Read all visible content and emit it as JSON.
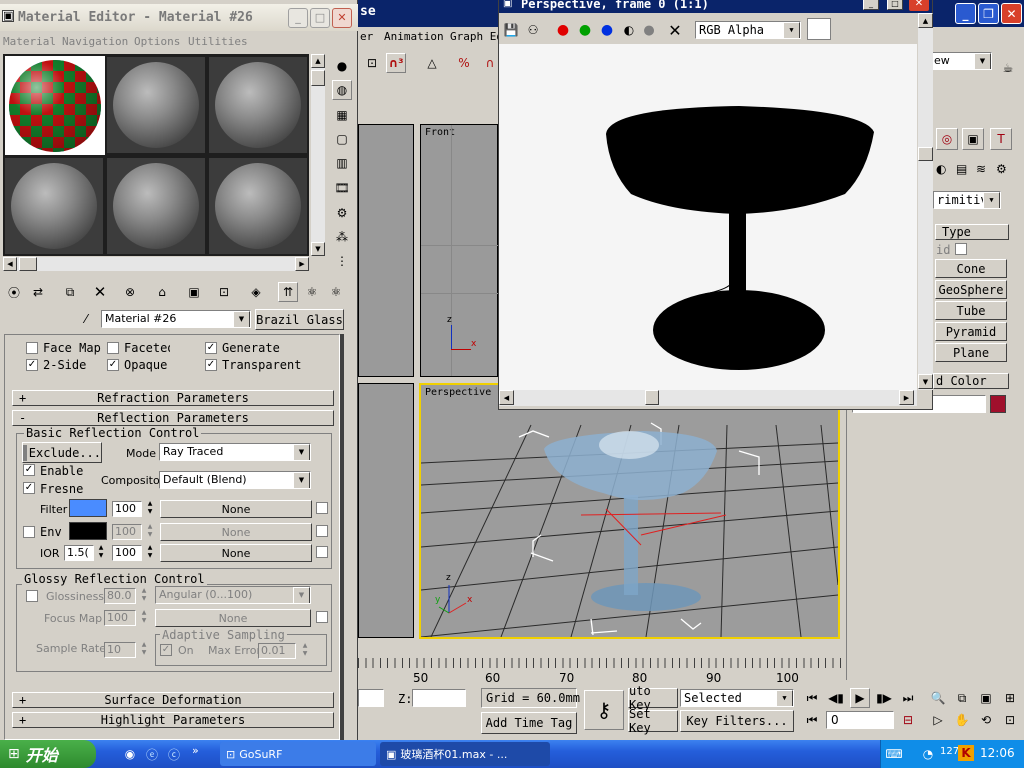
{
  "material_editor": {
    "title": "Material Editor - Material #26",
    "menu": [
      "Material",
      "Navigation",
      "Options",
      "Utilities"
    ],
    "material_name": "Material #26",
    "material_type": "Brazil Glass",
    "checks": [
      {
        "label": "Face Map",
        "checked": false
      },
      {
        "label": "Faceted",
        "checked": false
      },
      {
        "label": "Generate",
        "checked": true
      },
      {
        "label": "2-Side",
        "checked": true
      },
      {
        "label": "Opaque",
        "checked": true
      },
      {
        "label": "Transparent",
        "checked": true
      }
    ],
    "rollouts": {
      "refraction": "Refraction Parameters",
      "reflection": "Reflection Parameters",
      "surface": "Surface Deformation",
      "highlight": "Highlight Parameters",
      "plus": "+",
      "minus": "-"
    },
    "basic": {
      "group": "Basic Reflection Control",
      "exclude": "Exclude...",
      "mode_label": "Mode",
      "mode_value": "Ray Traced",
      "enable": "Enable",
      "fresnel": "Fresne",
      "compositor_label": "Compositor",
      "compositor_value": "Default (Blend)",
      "filter_label": "Filter",
      "filter_amount": "100",
      "filter_map": "None",
      "env_label": "Env",
      "env_amount": "100",
      "env_map": "None",
      "ior_label": "IOR",
      "ior_value": "1.5(",
      "ior_amount": "100",
      "ior_map": "None",
      "filter_color": "#4a8cff",
      "env_color": "#000000"
    },
    "glossy": {
      "group": "Glossy Reflection Control",
      "glossiness_label": "Glossiness",
      "glossiness_value": "80.0",
      "glossiness_mode": "Angular (0...100)",
      "focus_label": "Focus Map",
      "focus_value": "100",
      "focus_map": "None",
      "sample_label": "Sample Rate",
      "sample_value": "10",
      "adaptive_group": "Adaptive Sampling",
      "on_label": "On",
      "max_error_label": "Max Error",
      "max_error_value": "0.01"
    }
  },
  "main_window": {
    "menu_fragments": [
      "er",
      "Animation",
      "Graph Ed"
    ],
    "title_fragment": "se",
    "view_label": "ew",
    "viewport_front": "Front",
    "viewport_perspective": "Perspective",
    "axis": {
      "z": "z",
      "x": "x",
      "y": "y"
    }
  },
  "render_window": {
    "title": "Perspective, frame 0 (1:1)",
    "channel": "RGB Alpha"
  },
  "command_panel": {
    "category": "rimitiv",
    "type_header": "Type",
    "autogrid": "id",
    "buttons": [
      "Cone",
      "GeoSphere",
      "Tube",
      "Pyramid",
      "Plane"
    ],
    "color_header": "d Color",
    "object_color": "#a0102c"
  },
  "timeline": {
    "ticks": [
      "50",
      "60",
      "70",
      "80",
      "90",
      "100"
    ],
    "z_label": "Z:",
    "grid": "Grid = 60.0mm",
    "add_time_tag": "Add Time Tag",
    "auto_key": "uto Key",
    "set_key": "Set Key",
    "selected": "Selected",
    "key_filters": "Key Filters...",
    "frame": "0"
  },
  "taskbar": {
    "start": "开始",
    "tasks": [
      "GoSuRF",
      "玻璃酒杯01.max - ..."
    ],
    "tray_number": "127",
    "clock": "12:06"
  }
}
